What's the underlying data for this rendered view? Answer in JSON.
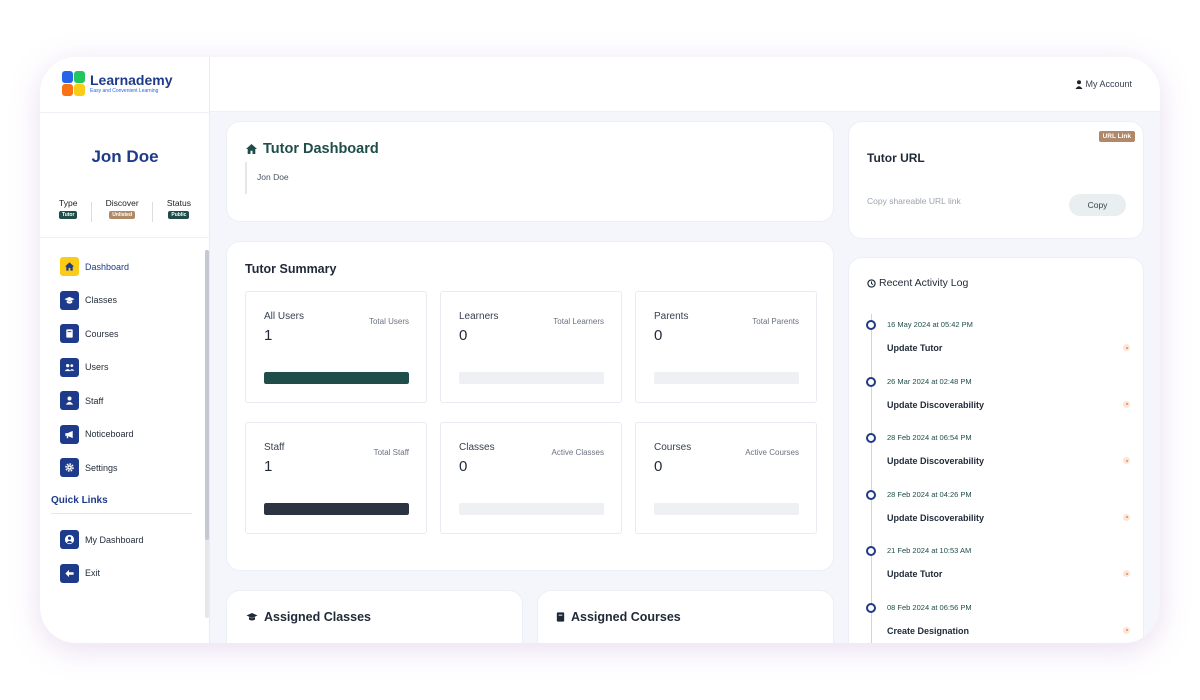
{
  "app": {
    "logo_name": "Learnademy",
    "logo_tagline": "Easy and Convenient Learning"
  },
  "topbar": {
    "account_label": "My Account",
    "account_icon": "user-icon"
  },
  "profile": {
    "name": "Jon Doe",
    "stats": [
      {
        "label": "Type",
        "badge": "Tutor",
        "color": "#1e4d4a"
      },
      {
        "label": "Discover",
        "badge": "Unlisted",
        "color": "#b08968"
      },
      {
        "label": "Status",
        "badge": "Public",
        "color": "#1e4d4a"
      }
    ]
  },
  "nav": {
    "items": [
      {
        "label": "Dashboard",
        "icon": "home-icon",
        "active": true
      },
      {
        "label": "Classes",
        "icon": "graduation-cap-icon"
      },
      {
        "label": "Courses",
        "icon": "book-icon"
      },
      {
        "label": "Users",
        "icon": "users-icon"
      },
      {
        "label": "Staff",
        "icon": "user-icon"
      },
      {
        "label": "Noticeboard",
        "icon": "bullhorn-icon"
      },
      {
        "label": "Settings",
        "icon": "gear-icon"
      }
    ],
    "quick_links_title": "Quick Links",
    "quick_links": [
      {
        "label": "My Dashboard",
        "icon": "user-circle-icon"
      },
      {
        "label": "Exit",
        "icon": "arrow-left-icon"
      }
    ]
  },
  "dashboard": {
    "title": "Tutor Dashboard",
    "subtitle": "Jon Doe"
  },
  "summary": {
    "title": "Tutor Summary",
    "stats": [
      {
        "label": "All Users",
        "value": "1",
        "sub": "Total Users",
        "fill": 1,
        "color": "#1e4d4a"
      },
      {
        "label": "Learners",
        "value": "0",
        "sub": "Total Learners",
        "fill": 0,
        "color": "#1e4d4a"
      },
      {
        "label": "Parents",
        "value": "0",
        "sub": "Total Parents",
        "fill": 0,
        "color": "#1e4d4a"
      },
      {
        "label": "Staff",
        "value": "1",
        "sub": "Total Staff",
        "fill": 1,
        "color": "#2b3440"
      },
      {
        "label": "Classes",
        "value": "0",
        "sub": "Active Classes",
        "fill": 0,
        "color": "#2b3440"
      },
      {
        "label": "Courses",
        "value": "0",
        "sub": "Active Courses",
        "fill": 0,
        "color": "#2b3440"
      }
    ]
  },
  "assigned": {
    "classes_title": "Assigned Classes",
    "courses_title": "Assigned Courses"
  },
  "tutor_url": {
    "title": "Tutor URL",
    "badge": "URL Link",
    "placeholder": "Copy shareable URL link",
    "copy_label": "Copy"
  },
  "activity": {
    "title": "Recent Activity Log",
    "items": [
      {
        "date": "16 May 2024 at 05:42 PM",
        "text": "Update Tutor"
      },
      {
        "date": "26 Mar 2024 at 02:48 PM",
        "text": "Update Discoverability"
      },
      {
        "date": "28 Feb 2024 at 06:54 PM",
        "text": "Update Discoverability"
      },
      {
        "date": "28 Feb 2024 at 04:26 PM",
        "text": "Update Discoverability"
      },
      {
        "date": "21 Feb 2024 at 10:53 AM",
        "text": "Update Tutor"
      },
      {
        "date": "08 Feb 2024 at 06:56 PM",
        "text": "Create Designation"
      }
    ]
  }
}
